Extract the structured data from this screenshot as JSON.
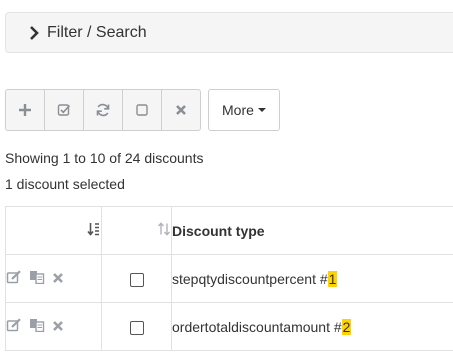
{
  "filter": {
    "label": "Filter / Search"
  },
  "toolbar": {
    "buttons": [
      {
        "icon": "plus-icon"
      },
      {
        "icon": "check-square-icon"
      },
      {
        "icon": "refresh-icon"
      },
      {
        "icon": "square-icon"
      },
      {
        "icon": "close-icon"
      }
    ],
    "more_label": "More"
  },
  "info": {
    "showing": "Showing 1 to 10 of 24 discounts",
    "selected": "1 discount selected"
  },
  "table": {
    "header": {
      "type": "Discount type"
    },
    "rows": [
      {
        "name": "stepqtydiscountpercent #",
        "id": "1"
      },
      {
        "name": "ordertotaldiscountamount #",
        "id": "2"
      }
    ]
  },
  "colors": {
    "highlight": "#ffd400",
    "icon": "#9aa0a6",
    "border": "#cfcfcf"
  }
}
